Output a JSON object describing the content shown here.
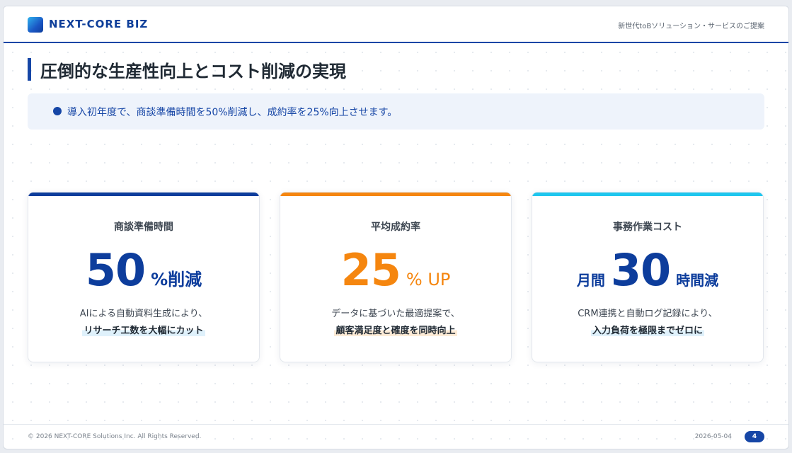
{
  "header": {
    "brand": "NEXT-CORE BIZ",
    "tagline": "新世代toBソリューション・サービスのご提案"
  },
  "title": "圧倒的な生産性向上とコスト削減の実現",
  "summary": "導入初年度で、商談準備時間を50%削減し、成約率を25%向上させます。",
  "cards": [
    {
      "label": "商談準備時間",
      "prefix": "",
      "value": "50",
      "unit": "%削減",
      "desc": "AIによる自動資料生成により、",
      "highlight": "リサーチ工数を大幅にカット",
      "accent": "#0d3d9c",
      "highlight_bg": "#dff1fb"
    },
    {
      "label": "平均成約率",
      "prefix": "",
      "value": "25",
      "unit": "% UP",
      "desc": "データに基づいた最適提案で、",
      "highlight": "顧客満足度と確度を同時向上",
      "accent": "#f5860f",
      "highlight_bg": "#fdebd6"
    },
    {
      "label": "事務作業コスト",
      "prefix": "月間",
      "value": "30",
      "unit": "時間減",
      "desc": "CRM連携と自動ログ記録により、",
      "highlight": "入力負荷を極限までゼロに",
      "accent": "#0d3d9c",
      "top_color": "#1fc6ee",
      "highlight_bg": "#dff1fb"
    }
  ],
  "footer": {
    "copyright": "© 2026 NEXT-CORE Solutions Inc. All Rights Reserved.",
    "date": "2026-05-04",
    "page": "4"
  },
  "colors": {
    "primary": "#1646a6",
    "accent_orange": "#f5860f",
    "accent_cyan": "#1fc6ee",
    "summary_bg": "#eef3fb"
  }
}
